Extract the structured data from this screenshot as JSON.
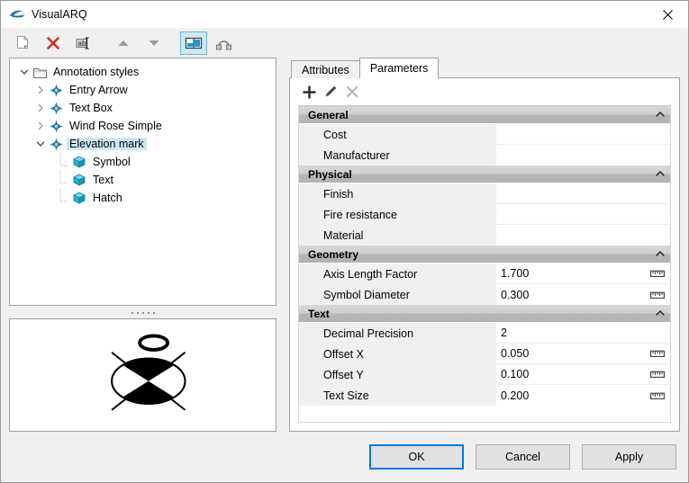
{
  "window": {
    "title": "VisualARQ",
    "icon": "visualarq-logo-icon",
    "close_label": "✕"
  },
  "toolbar": {
    "buttons": [
      {
        "name": "new-style-button",
        "icon": "new-document-icon",
        "tooltip": "New"
      },
      {
        "name": "delete-style-button",
        "icon": "delete-x-icon",
        "tooltip": "Delete"
      },
      {
        "name": "rename-style-button",
        "icon": "rename-ab-icon",
        "tooltip": "Rename"
      },
      {
        "name": "move-up-button",
        "icon": "arrow-up-icon",
        "tooltip": "Move Up"
      },
      {
        "name": "move-down-button",
        "icon": "arrow-down-icon",
        "tooltip": "Move Down"
      },
      {
        "name": "toggle-preview-button",
        "icon": "split-layout-icon",
        "tooltip": "Preview",
        "active": true
      },
      {
        "name": "curve-tool-button",
        "icon": "curve-nodes-icon",
        "tooltip": "Curve"
      }
    ]
  },
  "tree": {
    "nodes": [
      {
        "label": "Annotation styles",
        "level": 1,
        "icon": "folder-icon",
        "twist": "expanded",
        "selected": false
      },
      {
        "label": "Entry Arrow",
        "level": 2,
        "icon": "annotation-style-icon",
        "twist": "collapsed",
        "selected": false
      },
      {
        "label": "Text Box",
        "level": 2,
        "icon": "annotation-style-icon",
        "twist": "collapsed",
        "selected": false
      },
      {
        "label": "Wind Rose Simple",
        "level": 2,
        "icon": "annotation-style-icon",
        "twist": "collapsed",
        "selected": false
      },
      {
        "label": "Elevation mark",
        "level": 2,
        "icon": "annotation-style-icon",
        "twist": "expanded",
        "selected": true
      },
      {
        "label": "Symbol",
        "level": 3,
        "icon": "cube-icon",
        "twist": "none",
        "selected": false
      },
      {
        "label": "Text",
        "level": 3,
        "icon": "cube-icon",
        "twist": "none",
        "selected": false
      },
      {
        "label": "Hatch",
        "level": 3,
        "icon": "cube-icon",
        "twist": "none",
        "selected": false
      }
    ]
  },
  "preview": {
    "name": "elevation-mark-preview"
  },
  "tabs": [
    {
      "label": "Attributes",
      "active": false
    },
    {
      "label": "Parameters",
      "active": true
    }
  ],
  "param_toolbar": {
    "buttons": [
      {
        "name": "add-parameter-button",
        "icon": "plus-icon",
        "enabled": true
      },
      {
        "name": "edit-parameter-button",
        "icon": "pencil-icon",
        "enabled": true
      },
      {
        "name": "remove-parameter-button",
        "icon": "close-x-icon",
        "enabled": false
      }
    ]
  },
  "groups": [
    {
      "title": "General",
      "collapse_icon": "chevron-up-icon",
      "rows": [
        {
          "name": "Cost",
          "value": "",
          "unit_icon": ""
        },
        {
          "name": "Manufacturer",
          "value": "",
          "unit_icon": ""
        }
      ]
    },
    {
      "title": "Physical",
      "collapse_icon": "chevron-up-icon",
      "rows": [
        {
          "name": "Finish",
          "value": "",
          "unit_icon": ""
        },
        {
          "name": "Fire resistance",
          "value": "",
          "unit_icon": ""
        },
        {
          "name": "Material",
          "value": "",
          "unit_icon": ""
        }
      ]
    },
    {
      "title": "Geometry",
      "collapse_icon": "chevron-up-icon",
      "rows": [
        {
          "name": "Axis Length Factor",
          "value": "1.700",
          "unit_icon": "ruler-icon"
        },
        {
          "name": "Symbol Diameter",
          "value": "0.300",
          "unit_icon": "ruler-icon"
        }
      ]
    },
    {
      "title": "Text",
      "collapse_icon": "chevron-up-icon",
      "rows": [
        {
          "name": "Decimal Precision",
          "value": "2",
          "unit_icon": ""
        },
        {
          "name": "Offset X",
          "value": "0.050",
          "unit_icon": "ruler-icon"
        },
        {
          "name": "Offset Y",
          "value": "0.100",
          "unit_icon": "ruler-icon"
        },
        {
          "name": "Text Size",
          "value": "0.200",
          "unit_icon": "ruler-icon"
        }
      ]
    }
  ],
  "footer": {
    "ok_label": "OK",
    "cancel_label": "Cancel",
    "apply_label": "Apply"
  },
  "colors": {
    "accent": "#0078d7",
    "selection": "#cce8f6",
    "delete_red": "#d42a2a",
    "icon_teal": "#2d8fa8"
  }
}
